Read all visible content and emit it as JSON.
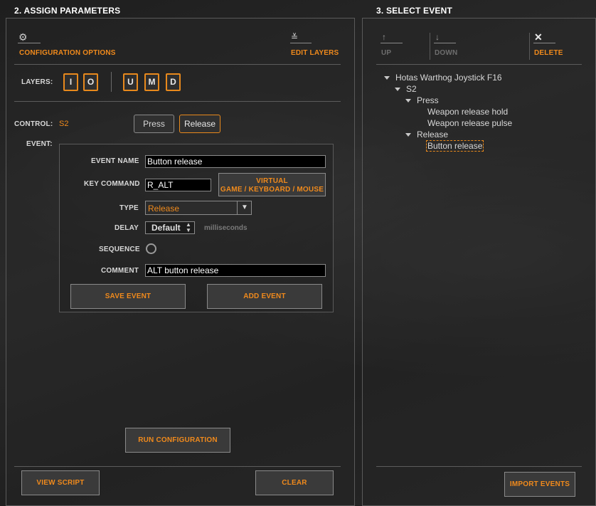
{
  "left": {
    "title": "2. ASSIGN PARAMETERS",
    "config_options": "CONFIGURATION OPTIONS",
    "edit_layers": "EDIT LAYERS",
    "layers_label": "LAYERS:",
    "layers_a": [
      "I",
      "O"
    ],
    "layers_b": [
      "U",
      "M",
      "D"
    ],
    "control_label": "CONTROL:",
    "control_value": "S2",
    "press_label": "Press",
    "release_label": "Release",
    "event_label": "EVENT:",
    "form": {
      "event_name_label": "EVENT NAME",
      "event_name_value": "Button release",
      "key_command_label": "KEY COMMAND",
      "key_command_value": "R_ALT",
      "virtual_line1": "VIRTUAL",
      "virtual_line2": "GAME / KEYBOARD / MOUSE",
      "type_label": "TYPE",
      "type_value": "Release",
      "delay_label": "DELAY",
      "delay_value": "Default",
      "delay_unit": "milliseconds",
      "sequence_label": "SEQUENCE",
      "comment_label": "COMMENT",
      "comment_value": "ALT button release",
      "save_event": "SAVE EVENT",
      "add_event": "ADD EVENT"
    },
    "run_configuration": "RUN CONFIGURATION",
    "view_script": "VIEW SCRIPT",
    "clear": "CLEAR"
  },
  "right": {
    "title": "3. SELECT EVENT",
    "up": "UP",
    "down": "DOWN",
    "delete": "DELETE",
    "tree": {
      "root": "Hotas Warthog Joystick F16",
      "control": "S2",
      "press": "Press",
      "press_items": [
        "Weapon release hold",
        "Weapon release pulse"
      ],
      "release": "Release",
      "release_items": [
        "Button release"
      ]
    },
    "import_events": "IMPORT EVENTS"
  },
  "colors": {
    "accent": "#f08a1c",
    "disabled": "#6e6e6e"
  },
  "icons": {
    "config": "gear-icon",
    "edit_layers": "edit-layers-icon",
    "up": "arrow-up-icon",
    "down": "arrow-down-icon",
    "delete": "close-icon",
    "sequence": "radio-circle-icon"
  }
}
